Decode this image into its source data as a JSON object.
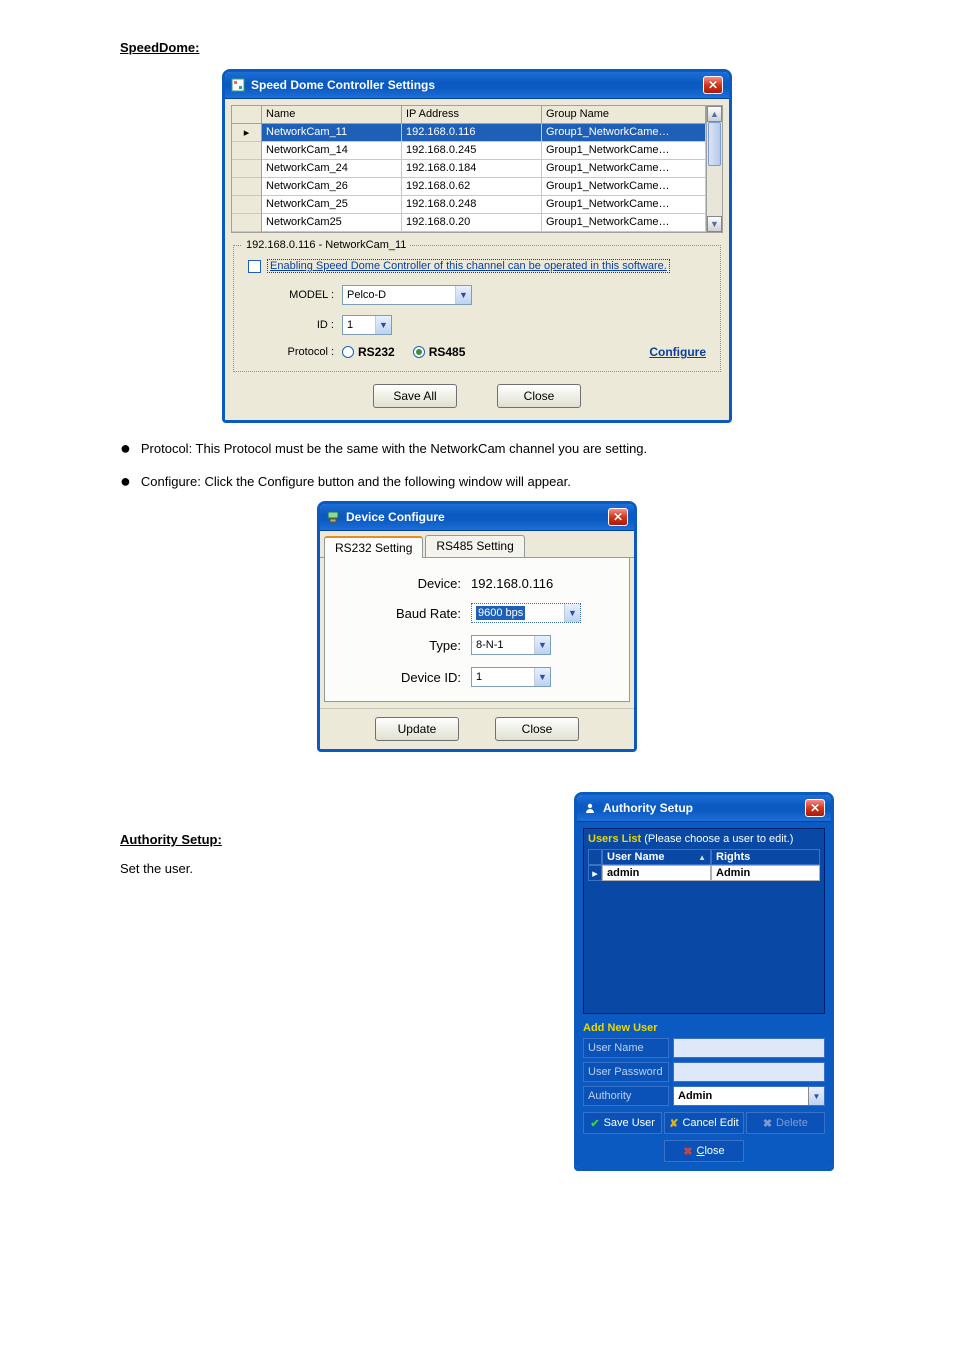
{
  "speedDome": {
    "heading": "SpeedDome:",
    "windowTitle": "Speed Dome Controller Settings",
    "columns": {
      "name": "Name",
      "ip": "IP Address",
      "group": "Group Name"
    },
    "rows": [
      {
        "name": "NetworkCam_11",
        "ip": "192.168.0.116",
        "group": "Group1_NetworkCame…",
        "selected": true,
        "marker": "▸"
      },
      {
        "name": "NetworkCam_14",
        "ip": "192.168.0.245",
        "group": "Group1_NetworkCame…",
        "selected": false
      },
      {
        "name": "NetworkCam_24",
        "ip": "192.168.0.184",
        "group": "Group1_NetworkCame…",
        "selected": false
      },
      {
        "name": "NetworkCam_26",
        "ip": "192.168.0.62",
        "group": "Group1_NetworkCame…",
        "selected": false
      },
      {
        "name": "NetworkCam_25",
        "ip": "192.168.0.248",
        "group": "Group1_NetworkCame…",
        "selected": false
      },
      {
        "name": "NetworkCam25",
        "ip": "192.168.0.20",
        "group": "Group1_NetworkCame…",
        "selected": false
      }
    ],
    "legend": "192.168.0.116 - NetworkCam_11",
    "enableLabel": "Enabling Speed Dome Controller of this channel can be operated in this software.",
    "modelLabel": "MODEL :",
    "modelValue": "Pelco-D",
    "idLabel": "ID :",
    "idValue": "1",
    "protocolLabel": "Protocol :",
    "protocolOptions": {
      "rs232": "RS232",
      "rs485": "RS485"
    },
    "protocolSelected": "RS485",
    "configureLabel": "Configure",
    "saveAllLabel": "Save All",
    "closeLabel": "Close"
  },
  "bullets": {
    "protocol": "Protocol: This Protocol must be the same with the NetworkCam channel you are setting.",
    "configure": "Configure: Click the Configure button and the following window will appear."
  },
  "deviceConfigure": {
    "windowTitle": "Device Configure",
    "tabs": {
      "rs232": "RS232 Setting",
      "rs485": "RS485 Setting"
    },
    "deviceLabel": "Device:",
    "deviceValue": "192.168.0.116",
    "baudLabel": "Baud Rate:",
    "baudValue": "9600 bps",
    "typeLabel": "Type:",
    "typeValue": "8-N-1",
    "deviceIdLabel": "Device ID:",
    "deviceIdValue": "1",
    "updateLabel": "Update",
    "closeLabel": "Close"
  },
  "authority": {
    "heading": "Authority Setup:",
    "intro": "Set the user.",
    "windowTitle": "Authority Setup",
    "listTitle": "Users List",
    "listHint": "(Please choose a user to edit.)",
    "columns": {
      "userName": "User Name",
      "rights": "Rights"
    },
    "rows": [
      {
        "marker": "▸",
        "userName": "admin",
        "rights": "Admin"
      }
    ],
    "addSection": "Add New User",
    "fields": {
      "userName": "User Name",
      "userPassword": "User Password",
      "authority": "Authority"
    },
    "authorityValue": "Admin",
    "buttons": {
      "saveUser": "Save User",
      "cancelEdit": "Cancel Edit",
      "delete": "Delete",
      "closePrefix": "C",
      "closeRest": "lose"
    }
  }
}
